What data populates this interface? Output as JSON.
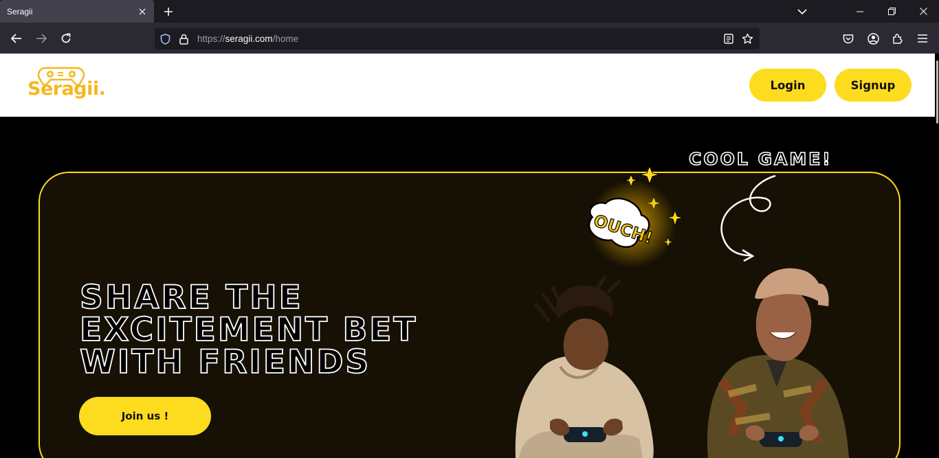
{
  "browser": {
    "tab_title": "Seragii",
    "url_prefix": "https://",
    "url_host": "seragii.com",
    "url_path": "/home"
  },
  "site": {
    "logo_text": "Seragii.",
    "login_label": "Login",
    "signup_label": "Signup"
  },
  "hero": {
    "title_line1": "SHARE THE",
    "title_line2": "EXCITEMENT BET",
    "title_line3": "WITH FRIENDS",
    "cta_label": "Join us !",
    "tagline": "COOL GAME!",
    "sticker_text": "OUCH!"
  },
  "colors": {
    "accent": "#fddc20",
    "logo": "#f4b81e",
    "hero_bg": "#161104"
  }
}
